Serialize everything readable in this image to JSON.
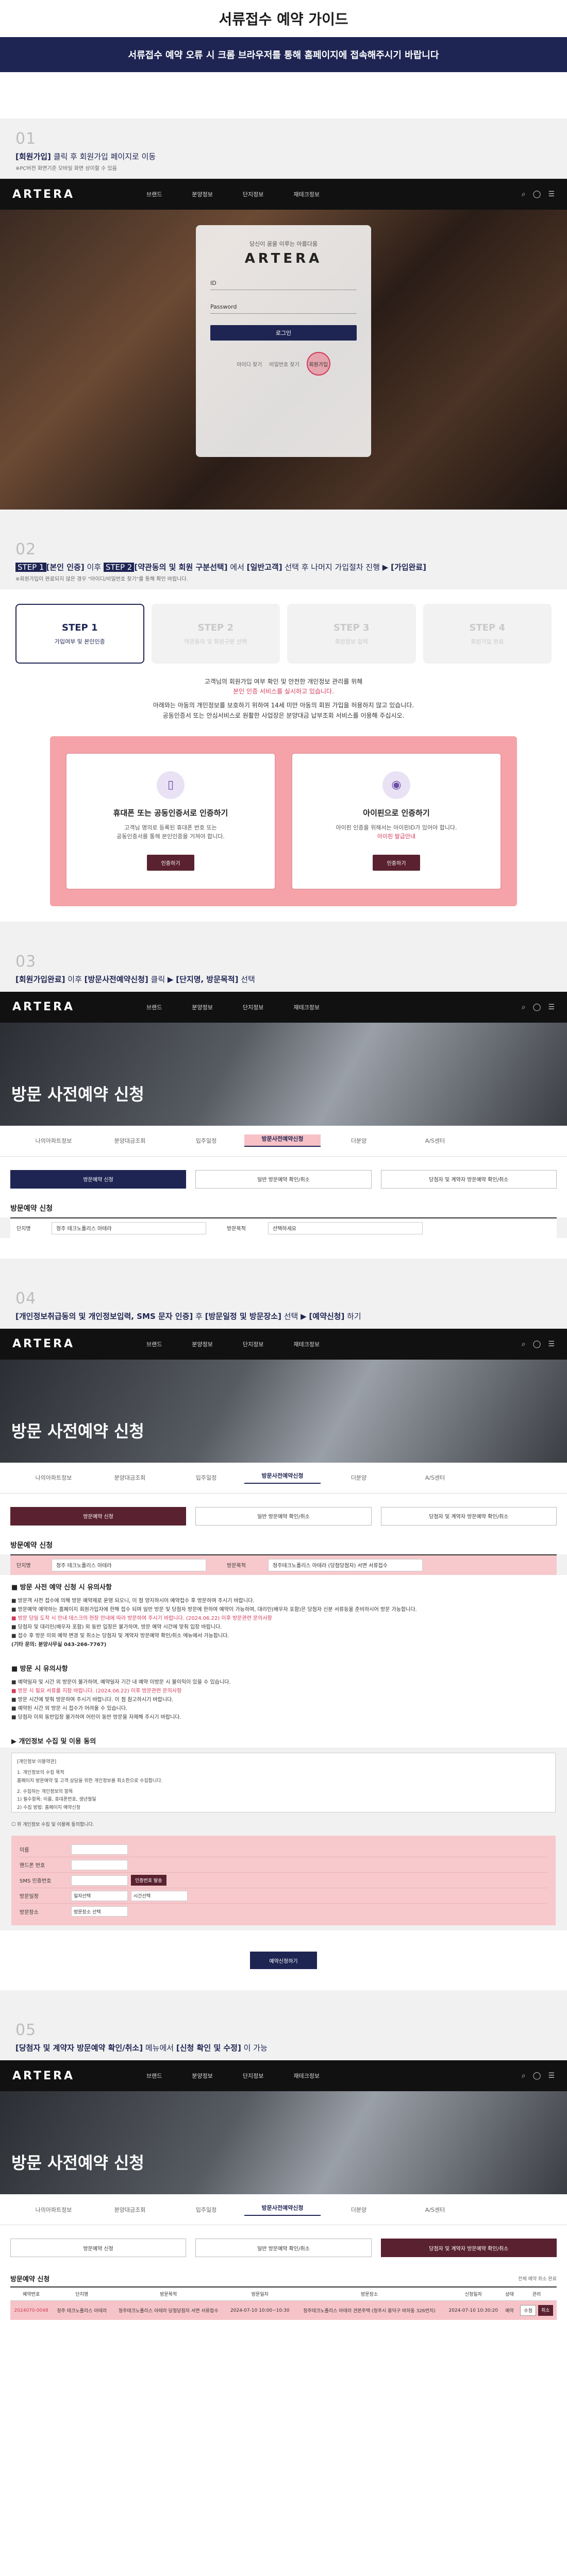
{
  "page": {
    "title": "서류접수 예약 가이드",
    "banner": "서류접수 예약 오류 시 크롬 브라우저를 통해 홈페이지에 접속해주시기 바랍니다"
  },
  "sections": {
    "s1": {
      "num": "01",
      "line_pre": "[회원가입]",
      "line_post": " 클릭 후 회원가입 페이지로 이동",
      "note": "※PC버전 화면기준 모바일 화면 상이할 수 있음"
    },
    "s2": {
      "num": "02",
      "line_a": "STEP 1",
      "line_b": "[본인 인증]",
      "line_c": " 이후 ",
      "line_d": "STEP 2",
      "line_e": "[약관동의 및 회원 구분선택]",
      "line_f": " 에서 ",
      "line_g": "[일반고객]",
      "line_h": " 선택 후 나머지 가입절차 진행 ▶ ",
      "line_i": "[가입완료]",
      "note": "※회원가입이 완료되지 않은 경우 \"아이디/비밀번호 찾기\"를 통해 확인 바랍니다."
    },
    "s3": {
      "num": "03",
      "line_a": "[회원가입완료]",
      "line_b": " 이후 ",
      "line_c": "[방문사전예약신청]",
      "line_d": " 클릭 ▶ ",
      "line_e": "[단지명, 방문목적]",
      "line_f": " 선택"
    },
    "s4": {
      "num": "04",
      "line_a": "[개인정보취급동의 및 개인정보입력, SMS 문자 인증]",
      "line_b": " 후 ",
      "line_c": "[방문일정 및 방문장소]",
      "line_d": " 선택 ▶ ",
      "line_e": "[예약신청]",
      "line_f": " 하기"
    },
    "s5": {
      "num": "05",
      "line_a": "[당첨자 및 계약자 방문예약 확인/취소]",
      "line_b": " 메뉴에서 ",
      "line_c": "[신청 확인 및 수정]",
      "line_d": " 이 가능"
    }
  },
  "header": {
    "logo": "ARTERA",
    "nav": [
      "브랜드",
      "분양정보",
      "단지정보",
      "재테크정보"
    ],
    "icons": [
      "search-icon",
      "user-icon",
      "menu-icon"
    ]
  },
  "login": {
    "sub": "당신이 꿈을 이루는 아름다움",
    "logo": "ARTERA",
    "id_label": "ID",
    "pw_label": "Password",
    "btn": "로그인",
    "find_id": "아이디 찾기",
    "find_pw": "비밀번호 찾기",
    "join": "회원가입"
  },
  "steps": [
    {
      "title": "STEP 1",
      "sub": "가입여부 및 본인인증"
    },
    {
      "title": "STEP 2",
      "sub": "약관동의 및 회원구분 선택"
    },
    {
      "title": "STEP 3",
      "sub": "회원정보 입력"
    },
    {
      "title": "STEP 4",
      "sub": "회원가입 완료"
    }
  ],
  "step_desc": {
    "l1": "고객님의 회원가입 여부 확인 및 안전한 개인정보 관리를 위해",
    "l2": "본인 인증 서비스를 실시하고 있습니다.",
    "l3": "아래와는 아동의 개인정보를 보호하기 위하여 14세 미만 아동의 회원 가입을 허용하지 않고 있습니다.",
    "l4": "공동인증서 또는 안심서비스로 원활한 사업장은 분양대금 납부조회 서비스를 이용해 주십시오."
  },
  "cert": [
    {
      "title": "휴대폰 또는 공동인증서로 인증하기",
      "t1": "고객님 명의로 등록된 휴대폰 번호 또는",
      "t2": "공동인증서를 통해 본인인증을 거쳐야 합니다.",
      "btn": "인증하기",
      "icon": "phone-icon"
    },
    {
      "title": "아이핀으로 인증하기",
      "t1": "아이핀 인증을 위해서는 아이핀ID가 있어야 합니다.",
      "t2": "아이핀 발급안내",
      "btn": "인증하기",
      "icon": "ipin-icon"
    }
  ],
  "reserve": {
    "hero": "방문 사전예약 신청",
    "tabs": [
      "나의아파트정보",
      "분양대금조회",
      "입주일정",
      "방문사전예약신청",
      "더분양",
      "A/S센터"
    ],
    "sub_tabs": [
      "방문예약 신청",
      "일반 방문예약 확인/취소",
      "당첨자 및 계약자 방문예약 확인/취소"
    ],
    "form_title": "방문예약 신청",
    "complex_label": "단지명",
    "complex_value": "청주 테크노폴리스 아테라",
    "purpose_label": "방문목적",
    "purpose_value": "선택하세요",
    "purpose_value2": "청주테크노폴리스 아테라 (당첨당첨자) 서면 서류접수"
  },
  "notice": {
    "h1": "■ 방문 사전 예약 신청 시 유의사항",
    "n1": "■ 방문객 사전 접수에 의해 방문 예약제로 운영 되오니, 이 점 양지하시어 예약접수 후 방문하여 주시기 바랍니다.",
    "n2": "■ 방문예약 예약하는 홈페이지 회원가입자에 한해 접수 되며 일반 방문 및 당첨자 방문에 한하여 예약이 가능하며, 대리인(배우자 포함)은 당첨자 신분 서류등을 준비하시어 방문 가능합니다.",
    "n3": "■ 방문 당일 도착 시 안내 데스크의 현장 안내에 따라 방문하여 주시기 바랍니다. (2024.06.22) 이후 방문관련 문의사항",
    "n4": "■ 당첨자 및 대리인(배우자 포함) 외 동반 입장은 불가하며, 방문 예약 시간에 맞춰 입장 바랍니다.",
    "n5": "■ 접수 후 방문 이외 예약 변경 및 취소는 당첨자 및 계약자 방문예약 확인/취소 메뉴에서 가능합니다.",
    "n6": "(기타 문의: 분양사무실 043-266-7767)",
    "h2": "■ 방문 시 유의사항",
    "m1": "■ 예약일자 및 시간 외 방문이 불가하며, 예약일자 기간 내 예약 미방문 시 불이익이 있을 수 있습니다.",
    "m2": "■ 방문 시 필요 서류를 지참 바랍니다. (2024.06.22) 이후 방문관련 문의사항",
    "m3": "■ 방문 시간에 맞춰 방문하여 주시기 바랍니다. 이 점 참고하시기 바랍니다.",
    "m4": "■ 예약된 시간 외 방문 시 접수가 어려울 수 있습니다.",
    "m5": "■ 당첨자 이외 동반입장 불가하며 어린이 동반 방문을 자제해 주시기 바랍니다."
  },
  "consent": {
    "title": "▶ 개인정보 수집 및 이용 동의",
    "body1": "[개인정보 이용약관]",
    "body2": "1. 개인정보의 수집 목적",
    "body3": "홈페이지 방문예약 및 고객 상담을 위한 개인정보를 최소한으로 수집합니다.",
    "body4": "2. 수집하는 개인정보의 항목",
    "body5": "1) 필수항목: 이름, 휴대폰번호, 생년월일",
    "body6": "2) 수집 방법: 홈페이지 예약신청",
    "agree": "위 개인정보 수집 및 이용에 동의합니다."
  },
  "inputs": {
    "name_label": "이름",
    "phone_label": "핸드폰 번호",
    "sms_label": "SMS 인증번호",
    "sms_btn": "인증번호 발송",
    "date_label": "방문일정",
    "date_value": "일자선택",
    "time_value": "시간선택",
    "place_label": "방문장소",
    "place_value": "방문장소 선택",
    "submit": "예약신청하기"
  },
  "table": {
    "title": "방문예약 신청",
    "filter": "전체  예약  취소  완료",
    "headers": [
      "예약번호",
      "단지명",
      "방문목적",
      "방문일자",
      "방문장소",
      "신청일자",
      "상태",
      "관리"
    ],
    "row": [
      "2024070-0048",
      "청주 테크노폴리스 아테라",
      "청주테크노폴리스 아테라 당첨당첨자 서면 서류접수",
      "2024-07-10 10:00~10:30",
      "청주테크노폴리스 아테라 견본주택 (청주시 흥덕구 비하동 326번지)",
      "2024-07-10 10:30:20",
      "예약",
      ""
    ],
    "btn_edit": "수정",
    "btn_cancel": "취소"
  }
}
